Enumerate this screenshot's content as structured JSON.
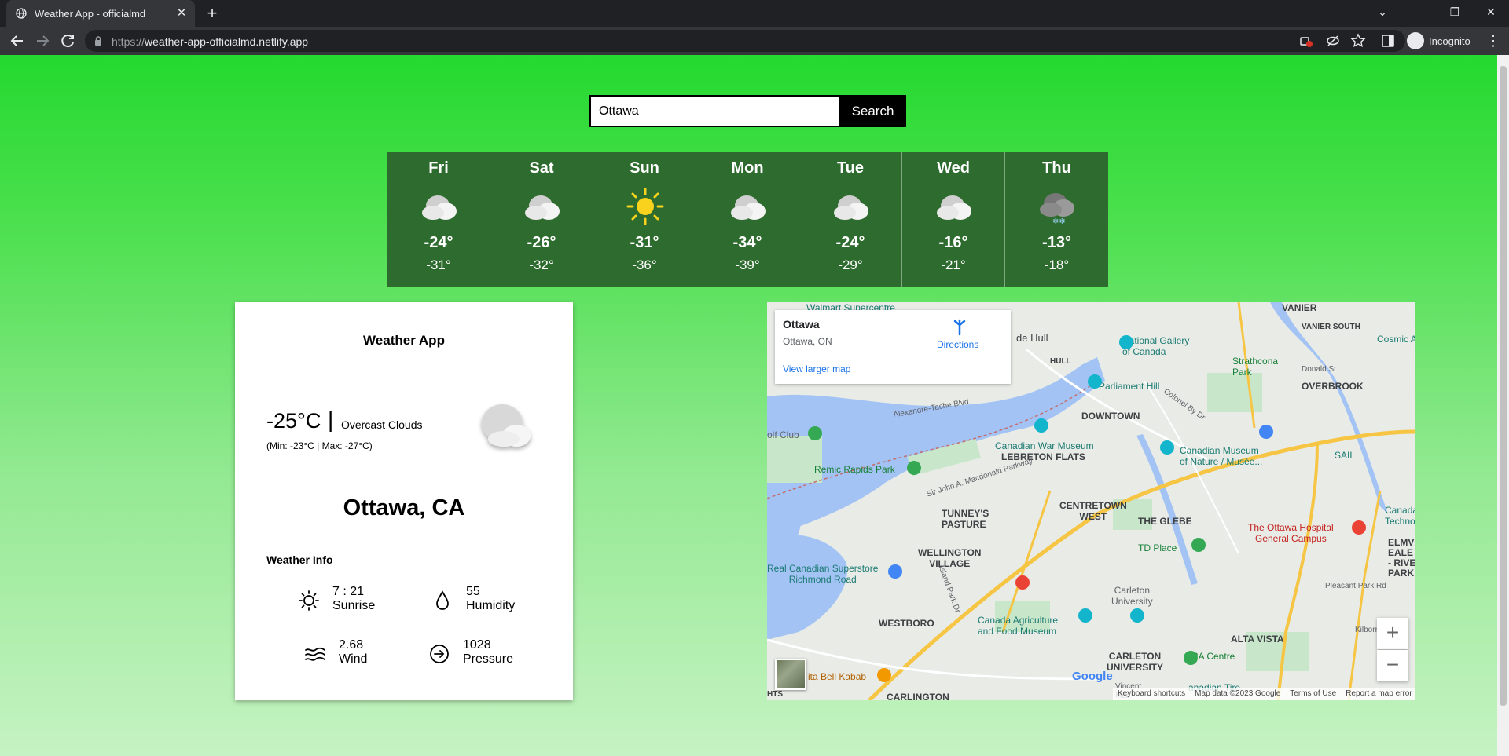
{
  "browser": {
    "tab_title": "Weather App - officialmd",
    "url_scheme": "https://",
    "url_host": "weather-app-officialmd.netlify.app",
    "profile_label": "Incognito"
  },
  "search": {
    "value": "Ottawa",
    "button_label": "Search"
  },
  "forecast": [
    {
      "day": "Fri",
      "icon": "cloud-icon",
      "max": "-24°",
      "min": "-31°"
    },
    {
      "day": "Sat",
      "icon": "cloud-icon",
      "max": "-26°",
      "min": "-32°"
    },
    {
      "day": "Sun",
      "icon": "sun-icon",
      "max": "-31°",
      "min": "-36°"
    },
    {
      "day": "Mon",
      "icon": "cloud-icon",
      "max": "-34°",
      "min": "-39°"
    },
    {
      "day": "Tue",
      "icon": "cloud-icon",
      "max": "-24°",
      "min": "-29°"
    },
    {
      "day": "Wed",
      "icon": "cloud-icon",
      "max": "-16°",
      "min": "-21°"
    },
    {
      "day": "Thu",
      "icon": "snow-cloud-icon",
      "max": "-13°",
      "min": "-18°"
    }
  ],
  "card": {
    "title": "Weather App",
    "temp": "-25°C",
    "separator": "|",
    "description": "Overcast Clouds",
    "minmax": "(Min: -23°C | Max: -27°C)",
    "city": "Ottawa, CA",
    "info_heading": "Weather Info",
    "stats": {
      "sunrise": {
        "value": "7 : 21",
        "label": "Sunrise"
      },
      "humidity": {
        "value": "55",
        "label": "Humidity"
      },
      "wind": {
        "value": "2.68",
        "label": "Wind"
      },
      "pressure": {
        "value": "1028",
        "label": "Pressure"
      }
    }
  },
  "map": {
    "place_name": "Ottawa",
    "place_address": "Ottawa, ON",
    "view_larger": "View larger map",
    "directions": "Directions",
    "zoom_in": "+",
    "zoom_out": "−",
    "google": "Google",
    "attribution": [
      "Keyboard shortcuts",
      "Map data ©2023 Google",
      "Terms of Use",
      "Report a map error"
    ],
    "labels": {
      "walmart": "Walmart Supercentre",
      "de_hull": "de Hull",
      "vanier": "VANIER",
      "vanier_south": "VANIER SOUTH",
      "cosmic": "Cosmic A",
      "national_gallery": "National Gallery\nof Canada",
      "strathcona": "Strathcona\nPark",
      "hull": "HULL",
      "donald": "Donald St",
      "overbrook": "OVERBROOK",
      "parliament": "Parliament Hill",
      "colonel": "Colonel By Dr",
      "alexandre": "Alexandre-Tache Blvd",
      "downtown": "DOWNTOWN",
      "golf": "olf Club",
      "war_museum": "Canadian War Museum",
      "lebreton": "LEBRETON FLATS",
      "museum_nature": "Canadian Museum\nof Nature / Musée...",
      "sail": "SAIL",
      "remic": "Remic Rapids Park",
      "macdonald": "Sir John A. Macdonald Parkway",
      "centretown_west": "CENTRETOWN\nWEST",
      "tunneys": "TUNNEY'S\nPASTURE",
      "glebe": "THE GLEBE",
      "hospital": "The Ottawa Hospital\nGeneral Campus",
      "canada_tech": "Canada\nTechno",
      "td_place": "TD Place",
      "wellington": "WELLINGTON\nVILLAGE",
      "superstore": "Real Canadian Superstore\nRichmond Road",
      "island_park": "Island Park Dr",
      "elmvale": "ELMV\nEALE\n- RIVE\nPARK",
      "pleasant": "Pleasant Park Rd",
      "carleton": "Carleton\nUniversity",
      "westboro": "WESTBORO",
      "agriculture": "Canada Agriculture\nand Food Museum",
      "kilborn": "Kilborn Ave",
      "alta_vista": "ALTA VISTA",
      "carleton_u": "CARLETON\nUNIVERSITY",
      "ra_centre": "RA Centre",
      "bell_kabab": "ita Bell Kabab",
      "carlington": "CARLINGTON",
      "vincent": "Vincent\nMas",
      "tire": "anadian Tire",
      "hts": "HTS"
    }
  },
  "colors": {
    "page_top": "#24d92f",
    "page_bottom": "#c6f3c3",
    "forecast_bg": "#2e6b2e",
    "search_button": "#000000"
  }
}
